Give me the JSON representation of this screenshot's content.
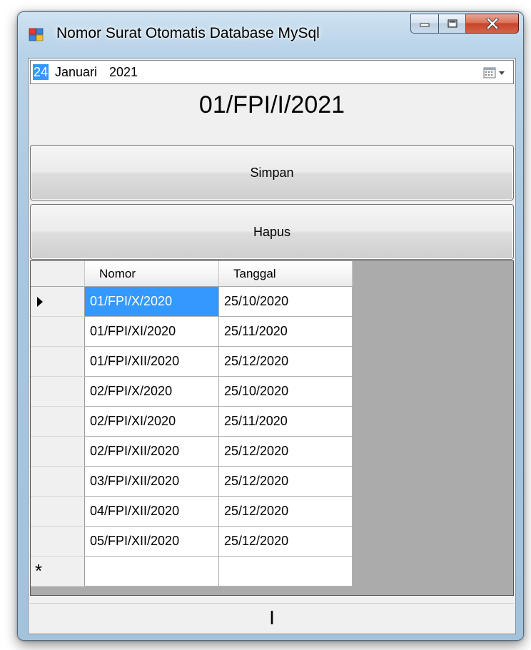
{
  "window": {
    "title": "Nomor Surat Otomatis Database MySql",
    "icon": "winforms-app-icon",
    "buttons": [
      "minimize-icon",
      "maximize-icon",
      "close-icon"
    ]
  },
  "date_picker": {
    "day": "24",
    "month": "Januari",
    "year": "2021",
    "dropdown_icon": "calendar-dropdown-icon"
  },
  "nomor_label": "01/FPI/I/2021",
  "buttons": {
    "simpan": "Simpan",
    "hapus": "Hapus"
  },
  "grid": {
    "columns": [
      "Nomor",
      "Tanggal"
    ],
    "rows": [
      {
        "nomor": "01/FPI/X/2020",
        "tanggal": "25/10/2020"
      },
      {
        "nomor": "01/FPI/XI/2020",
        "tanggal": "25/11/2020"
      },
      {
        "nomor": "01/FPI/XII/2020",
        "tanggal": "25/12/2020"
      },
      {
        "nomor": "02/FPI/X/2020",
        "tanggal": "25/10/2020"
      },
      {
        "nomor": "02/FPI/XI/2020",
        "tanggal": "25/11/2020"
      },
      {
        "nomor": "02/FPI/XII/2020",
        "tanggal": "25/12/2020"
      },
      {
        "nomor": "03/FPI/XII/2020",
        "tanggal": "25/12/2020"
      },
      {
        "nomor": "04/FPI/XII/2020",
        "tanggal": "25/12/2020"
      },
      {
        "nomor": "05/FPI/XII/2020",
        "tanggal": "25/12/2020"
      }
    ],
    "current_row_marker": "▶",
    "new_row_marker": "*",
    "selected_color": "#3399ff"
  },
  "status_label": "I"
}
